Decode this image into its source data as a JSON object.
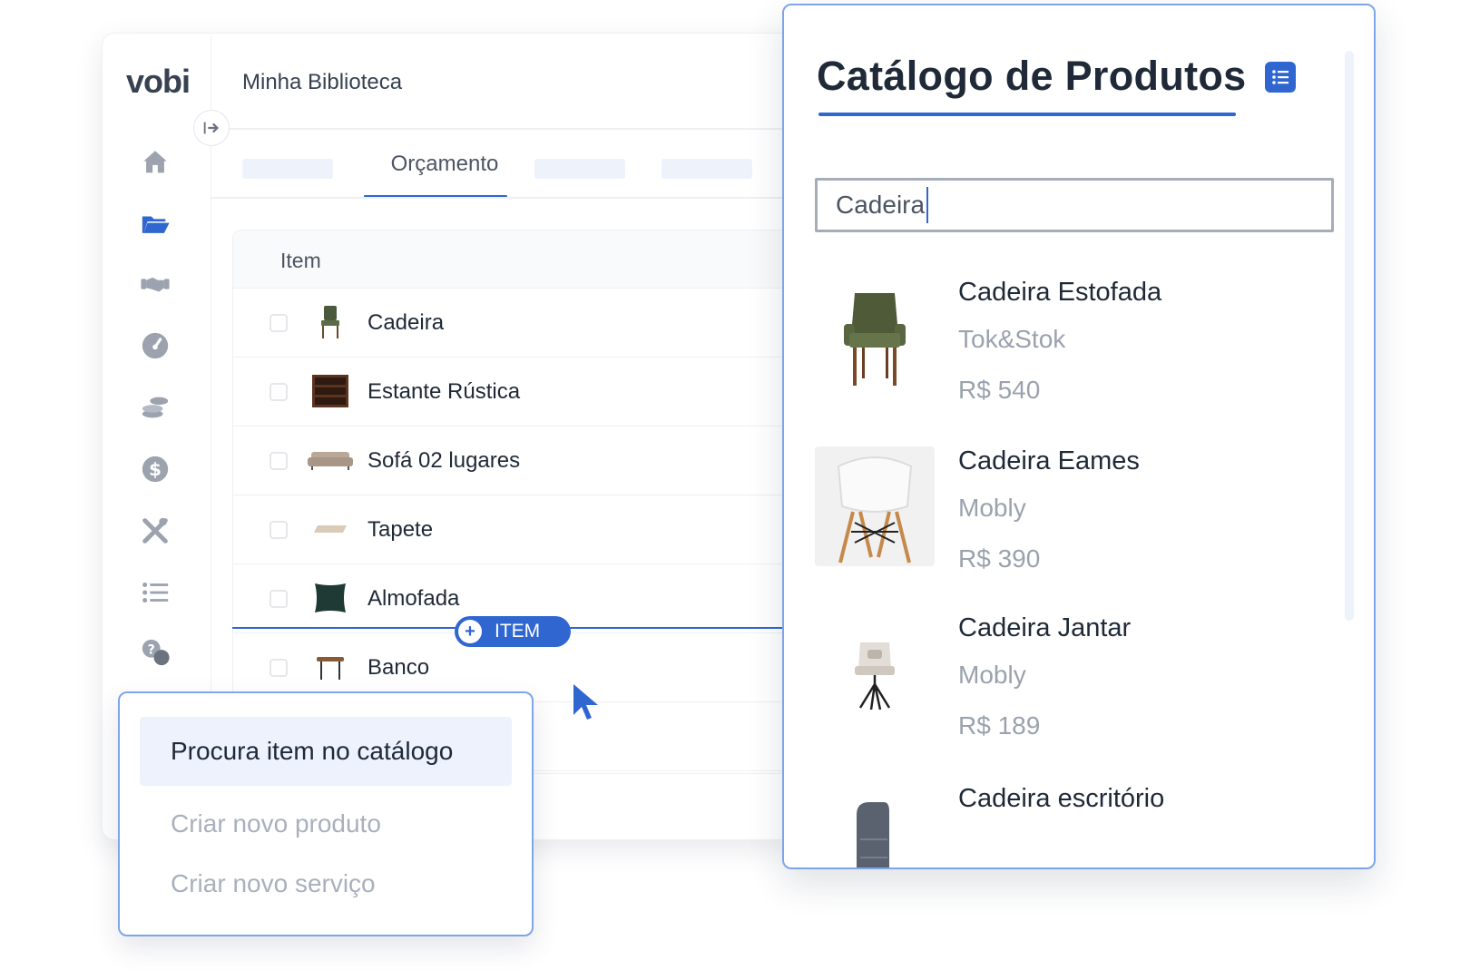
{
  "app": {
    "logo": "vobi",
    "page_title": "Minha Biblioteca",
    "active_tab": "Orçamento",
    "table_header": "Item",
    "rows": [
      {
        "name": "Cadeira"
      },
      {
        "name": "Estante Rústica"
      },
      {
        "name": "Sofá 02 lugares"
      },
      {
        "name": "Tapete"
      },
      {
        "name": "Almofada"
      },
      {
        "name": "Banco"
      }
    ],
    "insert_button": "ITEM"
  },
  "menu": {
    "items": [
      {
        "label": "Procura item no catálogo"
      },
      {
        "label": "Criar novo produto"
      },
      {
        "label": "Criar novo serviço"
      }
    ]
  },
  "catalog": {
    "title": "Catálogo de Produtos",
    "search_value": "Cadeira",
    "products": [
      {
        "name": "Cadeira Estofada",
        "brand": "Tok&Stok",
        "price": "R$ 540"
      },
      {
        "name": "Cadeira Eames",
        "brand": "Mobly",
        "price": "R$ 390"
      },
      {
        "name": "Cadeira Jantar",
        "brand": "Mobly",
        "price": "R$ 189"
      },
      {
        "name": "Cadeira escritório",
        "brand": "",
        "price": ""
      }
    ]
  },
  "colors": {
    "accent": "#2f66d0",
    "border_highlight": "#7ea5ea",
    "muted_text": "#9aa2ae"
  },
  "icons": [
    "home-icon",
    "folder-icon",
    "handshake-icon",
    "gauge-icon",
    "coins-icon",
    "dollar-icon",
    "tools-icon",
    "list-icon",
    "help-chat-icon",
    "collapse-arrow-icon",
    "cursor-icon",
    "catalog-list-icon"
  ]
}
